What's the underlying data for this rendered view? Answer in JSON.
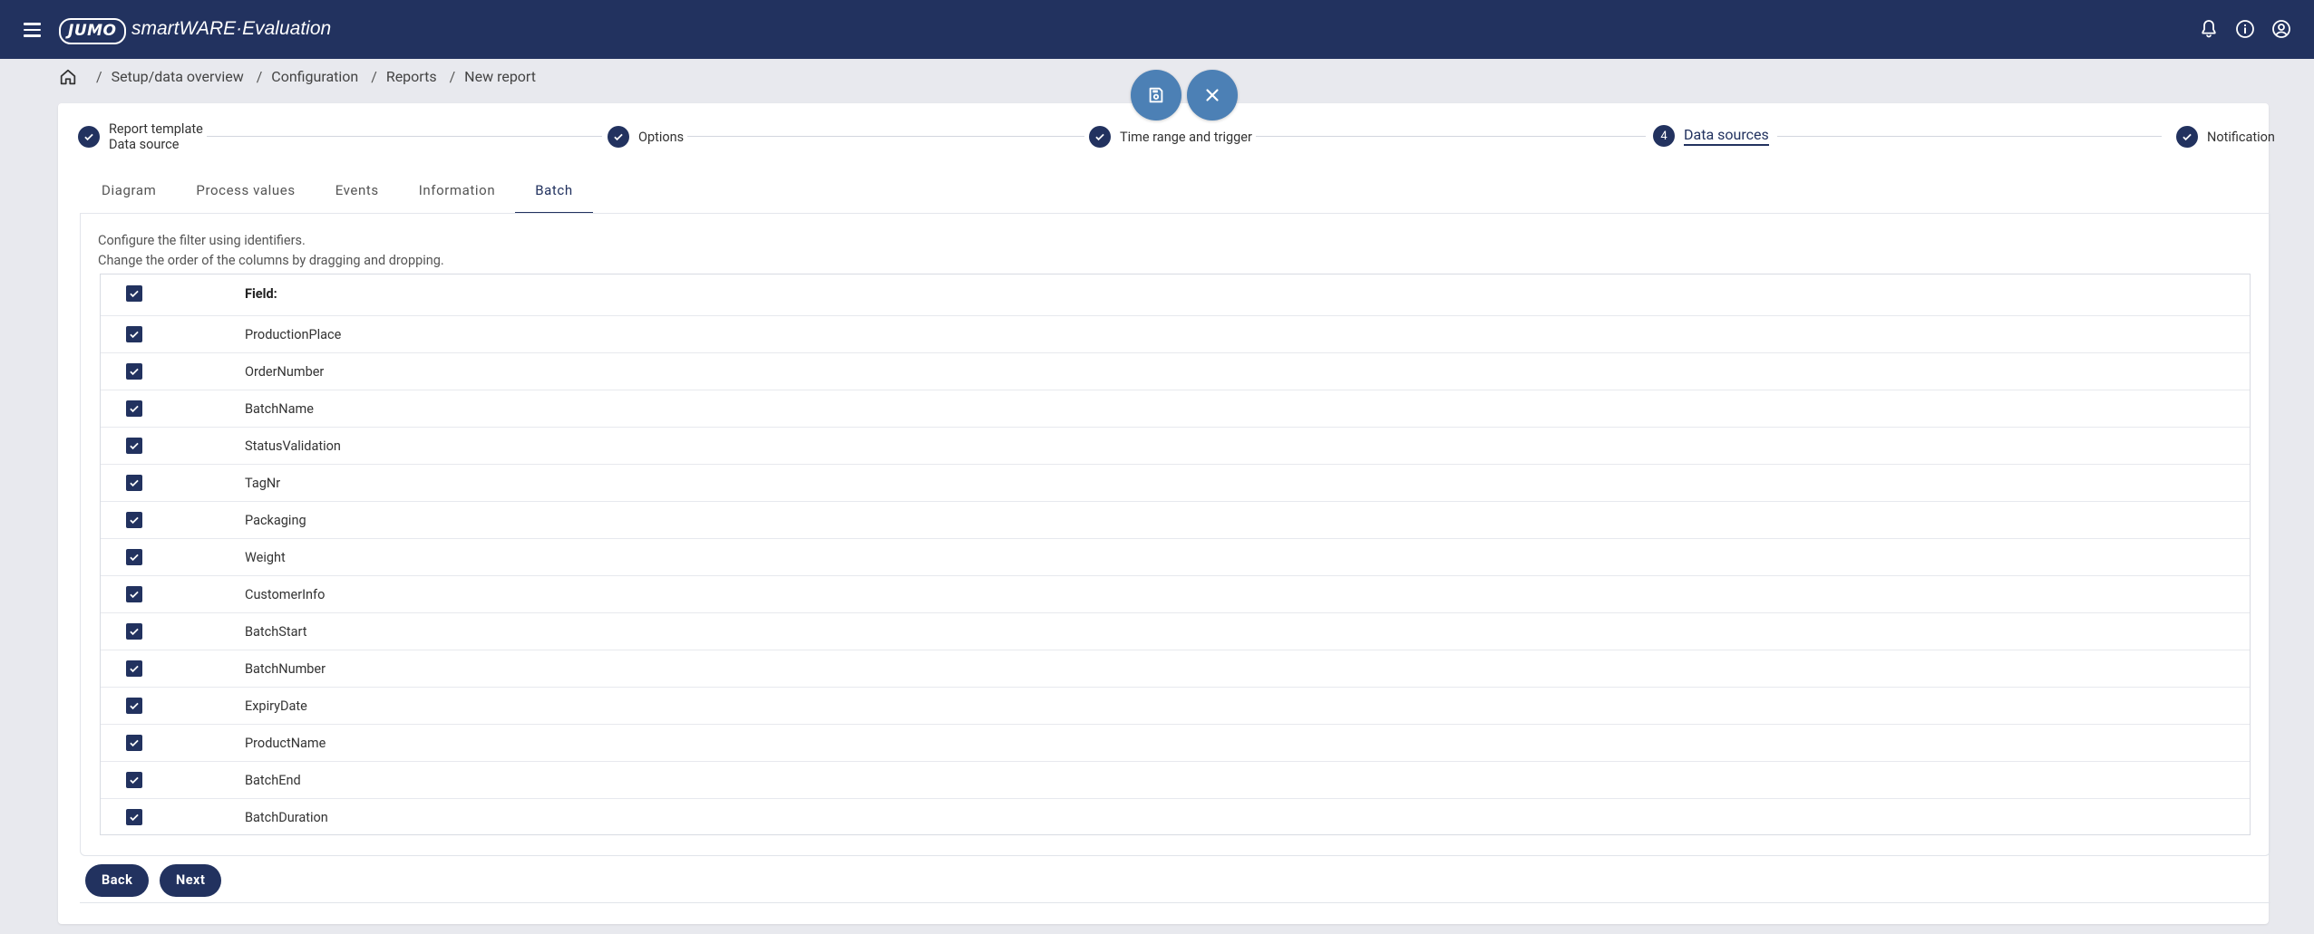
{
  "app": {
    "logo": "JUMO",
    "name": "smartWARE·Evaluation"
  },
  "breadcrumb": [
    "Setup/data overview",
    "Configuration",
    "Reports",
    "New report"
  ],
  "stepper": [
    {
      "label_line1": "Report template",
      "label_line2": "Data source",
      "state": "done"
    },
    {
      "label_line1": "Options",
      "state": "done"
    },
    {
      "label_line1": "Time range and trigger",
      "state": "done"
    },
    {
      "label_line1": "Data sources",
      "number": "4",
      "state": "active"
    },
    {
      "label_line1": "Notification",
      "state": "done"
    }
  ],
  "tabs": [
    "Diagram",
    "Process values",
    "Events",
    "Information",
    "Batch"
  ],
  "active_tab": "Batch",
  "description": {
    "line1": "Configure the filter using identifiers.",
    "line2": "Change the order of the columns by dragging and dropping."
  },
  "table": {
    "header": "Field:",
    "rows": [
      "ProductionPlace",
      "OrderNumber",
      "BatchName",
      "StatusValidation",
      "TagNr",
      "Packaging",
      "Weight",
      "CustomerInfo",
      "BatchStart",
      "BatchNumber",
      "ExpiryDate",
      "ProductName",
      "BatchEnd",
      "BatchDuration"
    ]
  },
  "buttons": {
    "back": "Back",
    "next": "Next"
  },
  "colors": {
    "primary": "#22325f",
    "fab": "#4c80b5",
    "background": "#e8e9ee"
  },
  "icons": [
    "menu-icon",
    "bell-icon",
    "info-icon",
    "account-icon",
    "home-icon",
    "save-icon",
    "close-icon",
    "check-icon"
  ]
}
